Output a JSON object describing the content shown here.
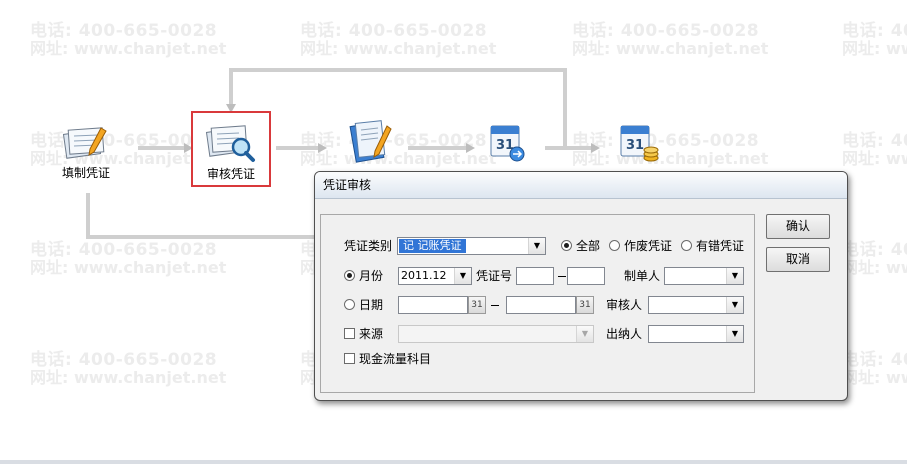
{
  "watermark": {
    "phone": "电话: 400-665-0028",
    "site": "网址: www.chanjet.net"
  },
  "flow": {
    "nodes": [
      {
        "label": "填制凭证",
        "icon": "voucher-fill-icon"
      },
      {
        "label": "审核凭证",
        "icon": "voucher-audit-icon"
      },
      {
        "label": "",
        "icon": "bookkeeping-icon"
      },
      {
        "label": "",
        "icon": "calendar-icon"
      },
      {
        "label": "",
        "icon": "calendar-coins-icon"
      }
    ]
  },
  "dialog": {
    "title": "凭证审核",
    "voucher_type_label": "凭证类别",
    "voucher_type_value": "记    记账凭证",
    "filter_options": [
      "全部",
      "作废凭证",
      "有错凭证"
    ],
    "filter_selected": "全部",
    "period_label": "月份",
    "period_value": "2011.12",
    "voucher_no_label": "凭证号",
    "maker_label": "制单人",
    "date_label": "日期",
    "auditor_label": "审核人",
    "source_label": "来源",
    "cashier_label": "出纳人",
    "cashflow_label": "现金流量科目",
    "calendar_button": "31",
    "ok_label": "确认",
    "cancel_label": "取消"
  }
}
